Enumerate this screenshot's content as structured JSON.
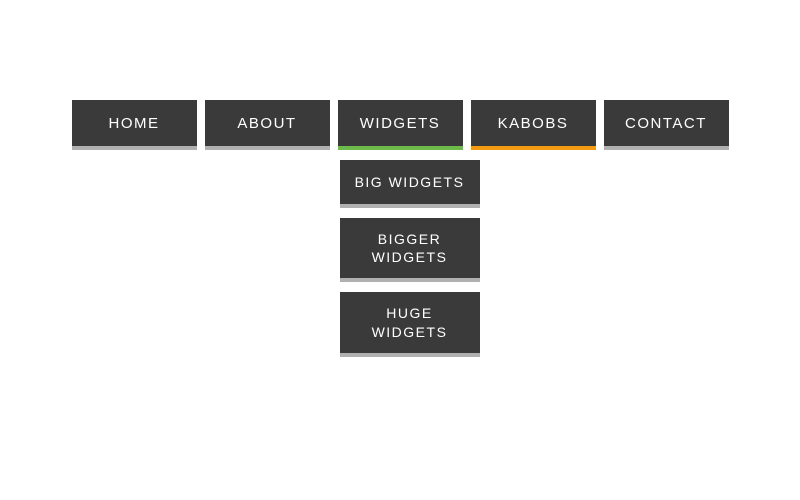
{
  "nav": {
    "items": [
      {
        "label": "HOME",
        "accent": "gray"
      },
      {
        "label": "ABOUT",
        "accent": "gray"
      },
      {
        "label": "WIDGETS",
        "accent": "green"
      },
      {
        "label": "KABOBS",
        "accent": "orange"
      },
      {
        "label": "CONTACT",
        "accent": "gray"
      }
    ]
  },
  "dropdown": {
    "parent": "WIDGETS",
    "items": [
      {
        "label": "BIG WIDGETS"
      },
      {
        "label": "BIGGER WIDGETS"
      },
      {
        "label": "HUGE WIDGETS"
      }
    ]
  },
  "colors": {
    "item_bg": "#3a3a3a",
    "text": "#ffffff",
    "underline_default": "#b0b0b0",
    "underline_green": "#6dbb4b",
    "underline_orange": "#f39c12"
  }
}
